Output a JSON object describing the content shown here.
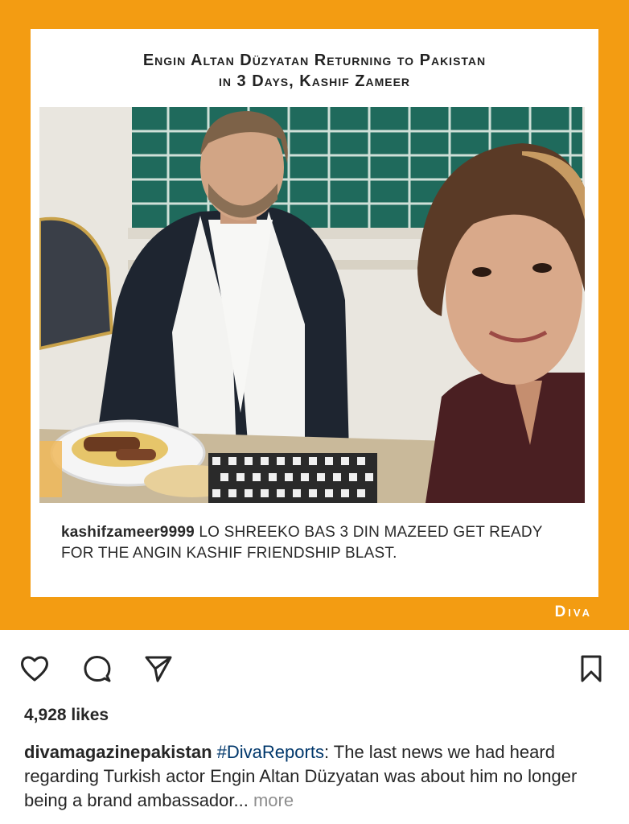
{
  "post": {
    "headline_line1": "Engin Altan Düzyatan Returning to Pakistan",
    "headline_line2": "in 3 Days, Kashif Zameer",
    "caption_handle": "kashifzameer9999",
    "caption_text": " LO SHREEKO BAS 3 DIN MAZEED GET READY FOR THE ANGIN KASHIF FRIENDSHIP BLAST.",
    "brand": "Diva"
  },
  "actions": {
    "icons": [
      "heart-icon",
      "comment-icon",
      "share-icon",
      "bookmark-icon"
    ]
  },
  "likes_text": "4,928 likes",
  "description": {
    "username": "divamagazinepakistan",
    "hashtag": "#DivaReports",
    "text": ": The last news we had heard regarding Turkish actor Engin Altan Düzyatan was about him no longer being a brand ambassador...",
    "more": " more"
  },
  "colors": {
    "frame": "#F39C12",
    "hashtag": "#00376b"
  }
}
